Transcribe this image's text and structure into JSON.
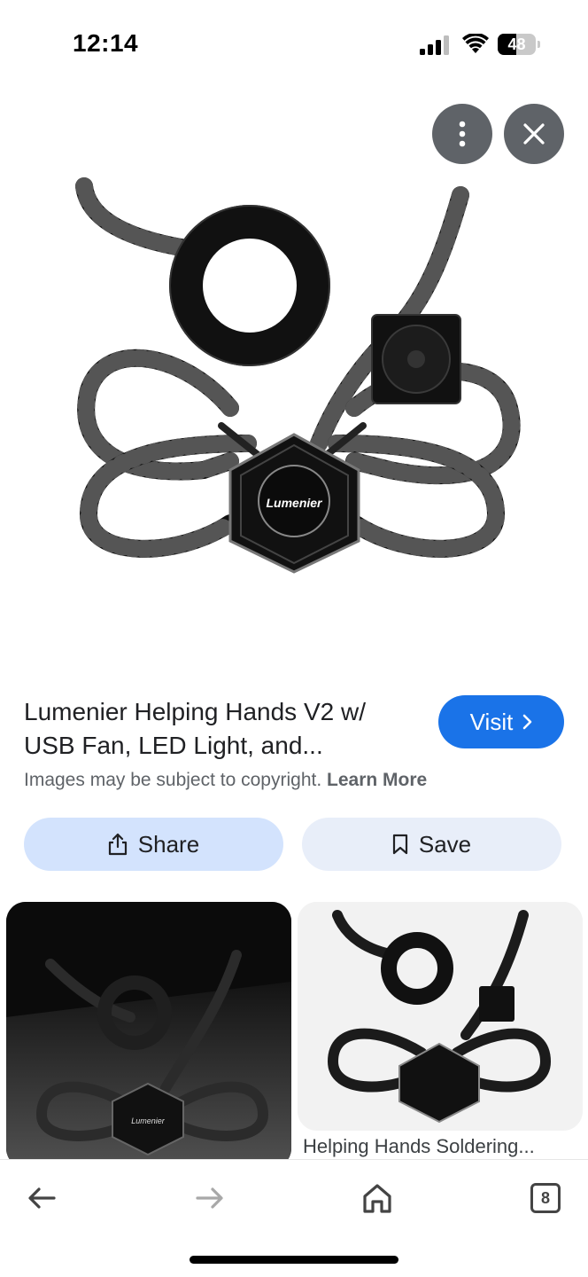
{
  "status_bar": {
    "time": "12:14",
    "battery": "48",
    "battery_level": 0.48
  },
  "viewer": {
    "more_icon": "vertical-dots-icon",
    "close_icon": "close-icon",
    "hero_brand": "Lumenier"
  },
  "result": {
    "title": "Lumenier Helping Hands V2 w/ USB Fan, LED Light, and...",
    "visit_label": "Visit",
    "visit_color": "#1a73e8",
    "copyright_text": "Images may be subject to copyright.",
    "learn_more": "Learn More",
    "share_label": "Share",
    "save_label": "Save"
  },
  "related": {
    "left_brand": "Lumenier",
    "right_caption": "Helping Hands Soldering..."
  },
  "bottom_nav": {
    "back_icon": "arrow-left-icon",
    "forward_icon": "arrow-right-icon",
    "home_icon": "home-icon",
    "tab_count": "8"
  }
}
